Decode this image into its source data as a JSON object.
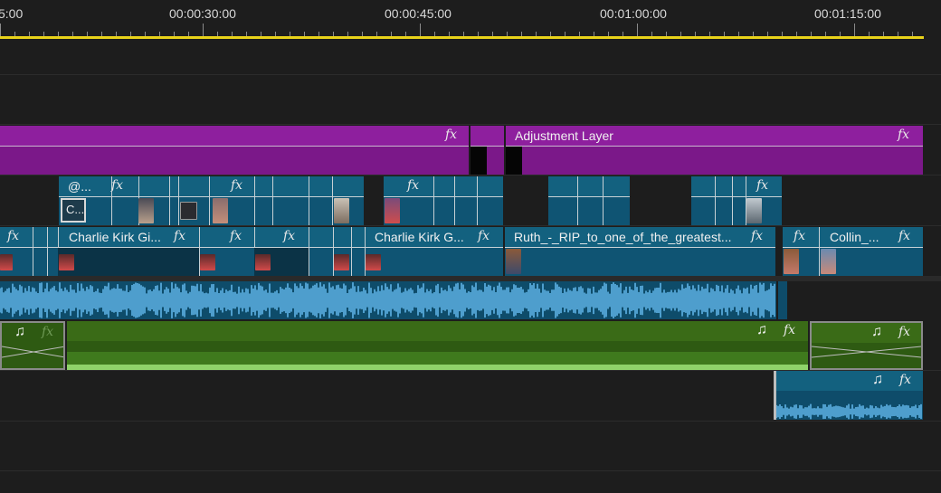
{
  "ruler": {
    "timecodes": [
      "5:00",
      "00:00:30:00",
      "00:00:45:00",
      "00:01:00:00",
      "00:01:15:00"
    ]
  },
  "tracks": {
    "adjustment": {
      "label": "Adjustment Layer",
      "fx_symbol": "fx"
    },
    "v2_clips": [
      {
        "label": "@..."
      },
      {
        "label": "C..."
      }
    ],
    "v1_clips": [
      {
        "label": "Charlie Kirk Gi..."
      },
      {
        "label": "Charlie Kirk G..."
      },
      {
        "label": "Ruth_-_RIP_to_one_of_the_greatest..."
      },
      {
        "label": "Collin_..."
      }
    ],
    "music_icon": "music-note-icon"
  },
  "colors": {
    "adjustment_layer": "#8e1f9e",
    "video_clip": "#13617f",
    "audio_waveform": "#5fb3e6",
    "music_track": "#3a6b17",
    "work_area_bar": "#e8d21a"
  }
}
